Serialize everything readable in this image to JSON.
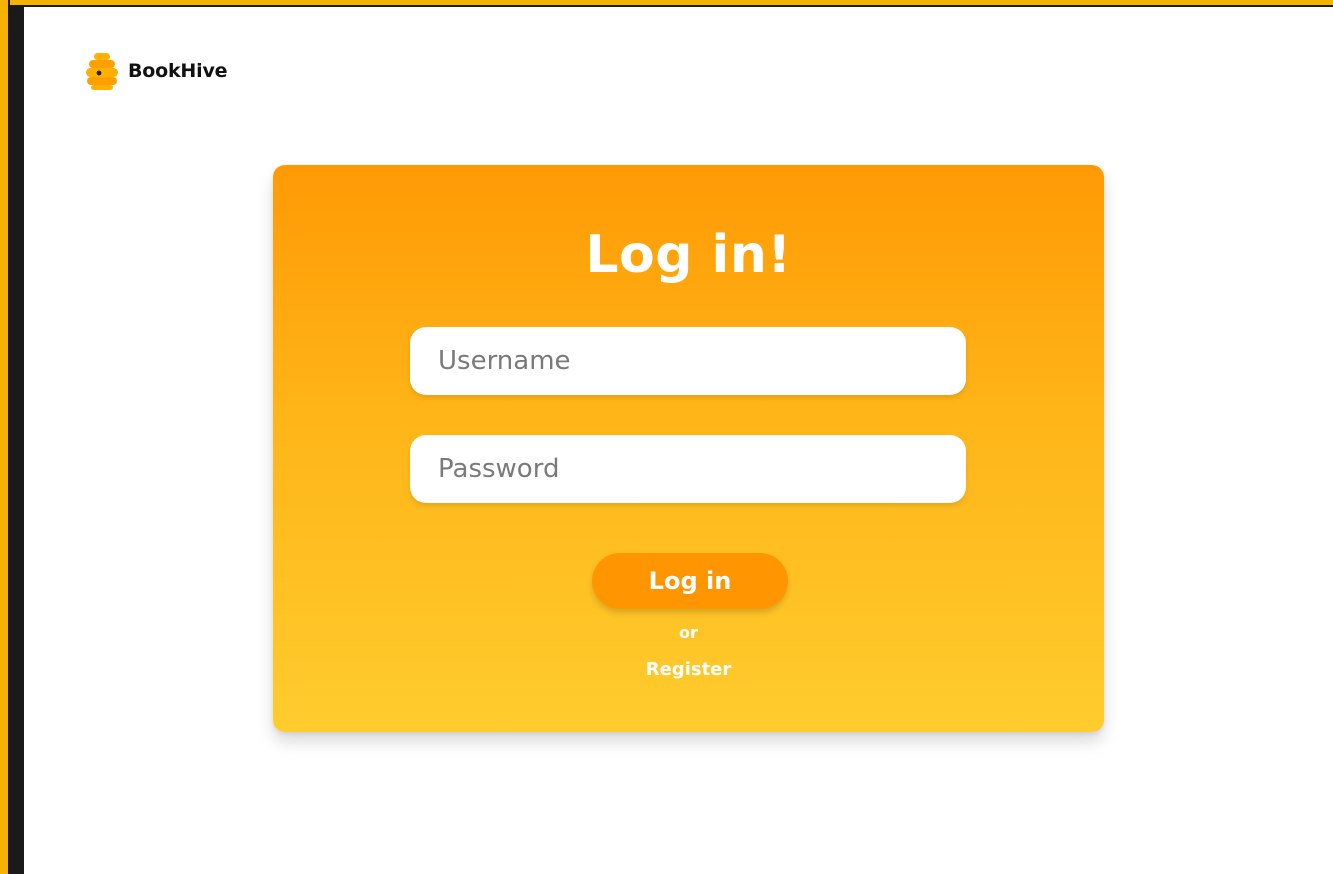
{
  "app": {
    "brand_name": "BookHive",
    "accent_color": "#ff9500",
    "frame_color": "#f5b300"
  },
  "header": {
    "logo_icon": "beehive-icon"
  },
  "login_card": {
    "title": "Log in!",
    "username": {
      "value": "",
      "placeholder": "Username"
    },
    "password": {
      "value": "",
      "placeholder": "Password"
    },
    "login_button_label": "Log in",
    "or_text": "or",
    "register_label": "Register"
  }
}
